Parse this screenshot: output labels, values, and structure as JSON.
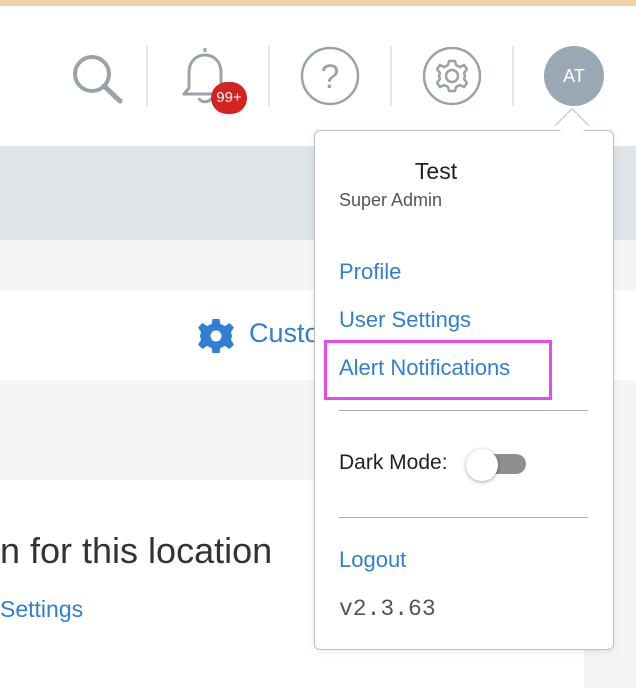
{
  "header": {
    "notifications_badge": "99+",
    "avatar_initials": "AT"
  },
  "background": {
    "customize_label": "Custo",
    "location_text": "n for this location",
    "settings_link": "Settings"
  },
  "user_menu": {
    "name": "Test",
    "role": "Super Admin",
    "items": [
      {
        "label": "Profile"
      },
      {
        "label": "User Settings"
      },
      {
        "label": "Alert Notifications"
      }
    ],
    "dark_mode_label": "Dark Mode:",
    "dark_mode_enabled": false,
    "logout_label": "Logout",
    "version": "v2.3.63"
  },
  "colors": {
    "link": "#2f7fd3",
    "badge": "#d32420",
    "highlight": "#e84ae8",
    "avatar_bg": "#9aa8b3"
  },
  "icons": {
    "search": "search-icon",
    "notifications": "bell-icon",
    "help": "help-icon",
    "settings": "gear-icon"
  }
}
